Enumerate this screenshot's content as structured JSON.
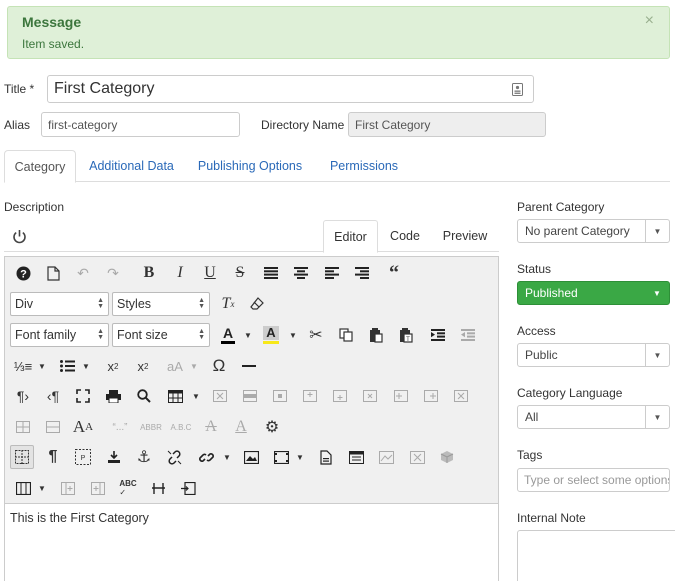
{
  "alert": {
    "heading": "Message",
    "text": "Item saved.",
    "close": "×"
  },
  "form": {
    "title_label": "Title *",
    "title_value": "First Category",
    "alias_label": "Alias",
    "alias_value": "first-category",
    "dirname_label": "Directory Name",
    "dirname_value": "First Category"
  },
  "tabs": [
    "Category",
    "Additional Data",
    "Publishing Options",
    "Permissions"
  ],
  "description_label": "Description",
  "editor_tabs": [
    "Editor",
    "Code",
    "Preview"
  ],
  "toolbar": {
    "format_select": "Div",
    "styles_select": "Styles",
    "font_family_select": "Font family",
    "font_size_select": "Font size"
  },
  "editor_content": "This is the First Category",
  "sidebar": {
    "parent_label": "Parent Category",
    "parent_value": "No parent Category",
    "status_label": "Status",
    "status_value": "Published",
    "access_label": "Access",
    "access_value": "Public",
    "language_label": "Category Language",
    "language_value": "All",
    "tags_label": "Tags",
    "tags_placeholder": "Type or select some options",
    "note_label": "Internal Note"
  },
  "colors": {
    "accent_green": "#3aa845",
    "link": "#2a69b8",
    "alert_bg": "#dff0d8"
  }
}
